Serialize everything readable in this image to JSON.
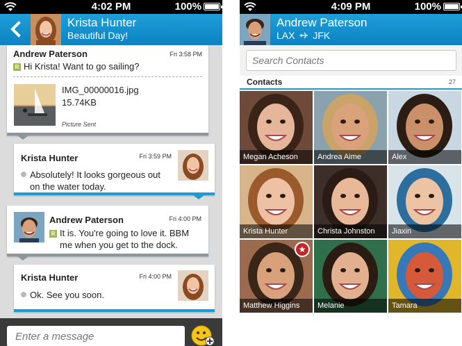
{
  "left_screen": {
    "status": {
      "time": "4:02 PM",
      "battery": "100%"
    },
    "header": {
      "name": "Krista Hunter",
      "status": "Beautiful Day!"
    },
    "messages": [
      {
        "sender": "Andrew Paterson",
        "time": "Fri 3:58 PM",
        "text": "Hi Krista! Want to go sailing?",
        "attachment": {
          "file": "IMG_00000016.jpg",
          "size": "15.74KB",
          "status": "Picture Sent"
        }
      },
      {
        "sender": "Krista Hunter",
        "time": "Fri 3:59 PM",
        "line1": "Absolutely! It looks gorgeous out",
        "line2": "on the water today."
      },
      {
        "sender": "Andrew Paterson",
        "time": "Fri 4:00 PM",
        "line1": "It is. You're going to love it. BBM",
        "line2": "me when you get to the dock."
      },
      {
        "sender": "Krista Hunter",
        "time": "Fri 4:00 PM",
        "line1": "Ok. See you soon."
      }
    ],
    "composer": {
      "placeholder": "Enter a message"
    },
    "read_badge": "R"
  },
  "right_screen": {
    "status": {
      "time": "4:09 PM",
      "battery": "100%"
    },
    "header": {
      "name": "Andrew Paterson",
      "from": "LAX",
      "to": "JFK"
    },
    "search": {
      "placeholder": "Search Contacts"
    },
    "contacts_title": "Contacts",
    "contacts_count": "27",
    "contacts": [
      {
        "name": "Megan Acheson",
        "bg": "#6f4a3a",
        "skin": "#e6b69a",
        "hair": "#3a2418"
      },
      {
        "name": "Andrea Aime",
        "bg": "#8aa2ad",
        "skin": "#d9a27a",
        "hair": "#c9a36a"
      },
      {
        "name": "Alex",
        "bg": "#c9d7e2",
        "skin": "#c9906a",
        "hair": "#2b1d14"
      },
      {
        "name": "Krista Hunter",
        "bg": "#d7b48a",
        "skin": "#eec0a4",
        "hair": "#9a5a2c"
      },
      {
        "name": "Christa Johnston",
        "bg": "#3c2f2a",
        "skin": "#e8b898",
        "hair": "#2a1b14"
      },
      {
        "name": "Jiaxin",
        "bg": "#d9e3ea",
        "skin": "#ecc3a3",
        "hair": "#2c6e9e"
      },
      {
        "name": "Matthew Higgins",
        "bg": "#9c6a4e",
        "skin": "#d9a07c",
        "hair": "#3a2519",
        "starred": true
      },
      {
        "name": "Melanie",
        "bg": "#2f6f4a",
        "skin": "#e3b08f",
        "hair": "#2a1c13"
      },
      {
        "name": "Tamara",
        "bg": "#e0b62b",
        "skin": "#d65a3a",
        "hair": "#3778b8"
      }
    ],
    "star_symbol": "★"
  }
}
